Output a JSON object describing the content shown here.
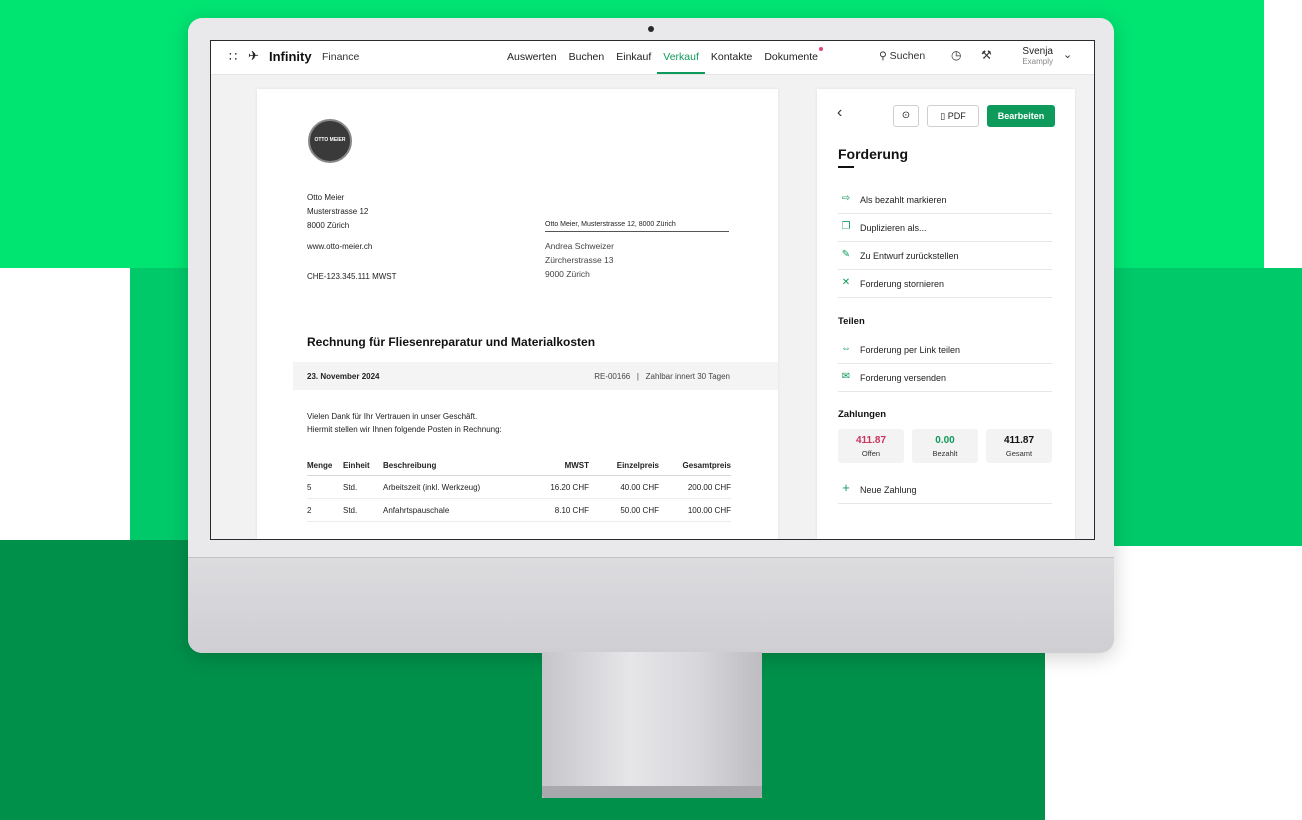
{
  "colors": {
    "accent": "#0e9a5a",
    "negative": "#c8335f",
    "bg_top": "#00e472",
    "bg_mid": "#00c96a",
    "bg_bottom": "#00904a"
  },
  "topbar": {
    "brand": "Infinity",
    "product": "Finance",
    "nav": [
      "Auswerten",
      "Buchen",
      "Einkauf",
      "Verkauf",
      "Kontakte",
      "Dokumente"
    ],
    "active_nav": "Verkauf",
    "search_label": "Suchen",
    "user_name": "Svenja",
    "user_company": "Examply",
    "icons": [
      "grid-icon",
      "logo-icon",
      "search-icon",
      "clock-icon",
      "wrench-icon",
      "chevron-down-icon"
    ]
  },
  "document": {
    "seal_text": "OTTO MEIER",
    "sender": [
      "Otto Meier",
      "Musterstrasse 12",
      "8000 Zürich"
    ],
    "website": "www.otto-meier.ch",
    "vat_id": "CHE-123.345.111 MWST",
    "return_address": "Otto Meier, Musterstrasse 12, 8000 Zürich",
    "recipient": [
      "Andrea Schweizer",
      "Zürcherstrasse 13",
      "9000 Zürich"
    ],
    "title": "Rechnung für Fliesenreparatur und Materialkosten",
    "date": "23. November 2024",
    "number": "RE-00166",
    "separator": "|",
    "terms": "Zahlbar innert 30 Tagen",
    "intro": [
      "Vielen Dank für Ihr Vertrauen in unser Geschäft.",
      "Hiermit stellen wir Ihnen folgende Posten in Rechnung:"
    ],
    "columns": [
      "Menge",
      "Einheit",
      "Beschreibung",
      "MWST",
      "Einzelpreis",
      "Gesamtpreis"
    ],
    "rows": [
      {
        "qty": "5",
        "unit": "Std.",
        "desc": "Arbeitszeit (inkl. Werkzeug)",
        "vat": "16.20 CHF",
        "unit_price": "40.00 CHF",
        "total": "200.00 CHF"
      },
      {
        "qty": "2",
        "unit": "Std.",
        "desc": "Anfahrtspauschale",
        "vat": "8.10 CHF",
        "unit_price": "50.00 CHF",
        "total": "100.00 CHF"
      }
    ]
  },
  "panel": {
    "pdf_label": "PDF",
    "edit_label": "Bearbeiten",
    "title": "Forderung",
    "actions": [
      {
        "label": "Als bezahlt markieren",
        "icon": "mark-paid-icon"
      },
      {
        "label": "Duplizieren als...",
        "icon": "duplicate-icon"
      },
      {
        "label": "Zu Entwurf zurückstellen",
        "icon": "draft-icon"
      },
      {
        "label": "Forderung stornieren",
        "icon": "close-icon"
      }
    ],
    "share_heading": "Teilen",
    "share_actions": [
      {
        "label": "Forderung per Link teilen",
        "icon": "link-icon"
      },
      {
        "label": "Forderung versenden",
        "icon": "mail-icon"
      }
    ],
    "payments_heading": "Zahlungen",
    "payments": [
      {
        "value": "411.87",
        "label": "Offen"
      },
      {
        "value": "0.00",
        "label": "Bezahlt"
      },
      {
        "value": "411.87",
        "label": "Gesamt"
      }
    ],
    "new_payment_label": "Neue Zahlung"
  }
}
